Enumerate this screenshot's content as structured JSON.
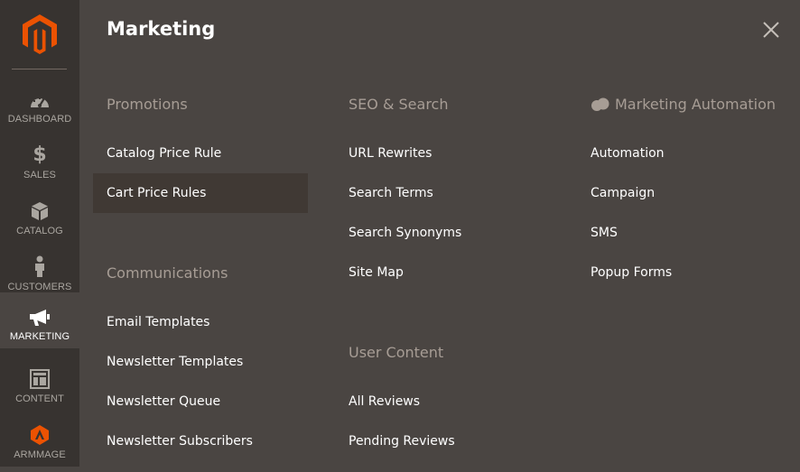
{
  "sidebar": {
    "items": [
      {
        "label": "DASHBOARD",
        "icon": "dashboard-icon"
      },
      {
        "label": "SALES",
        "icon": "dollar-icon"
      },
      {
        "label": "CATALOG",
        "icon": "box-icon"
      },
      {
        "label": "CUSTOMERS",
        "icon": "person-icon"
      },
      {
        "label": "MARKETING",
        "icon": "megaphone-icon",
        "active": true
      },
      {
        "label": "CONTENT",
        "icon": "layout-icon"
      },
      {
        "label": "ARMMAGE",
        "icon": "armmage-logo-icon"
      }
    ]
  },
  "panel": {
    "title": "Marketing",
    "columns": [
      {
        "sections": [
          {
            "title": "Promotions",
            "links": [
              "Catalog Price Rule",
              "Cart Price Rules"
            ]
          },
          {
            "title": "Communications",
            "links": [
              "Email Templates",
              "Newsletter Templates",
              "Newsletter Queue",
              "Newsletter Subscribers"
            ]
          }
        ]
      },
      {
        "sections": [
          {
            "title": "SEO & Search",
            "links": [
              "URL Rewrites",
              "Search Terms",
              "Search Synonyms",
              "Site Map"
            ]
          },
          {
            "title": "User Content",
            "links": [
              "All Reviews",
              "Pending Reviews"
            ]
          }
        ]
      },
      {
        "sections": [
          {
            "title": "Marketing Automation",
            "links": [
              "Automation",
              "Campaign",
              "SMS",
              "Popup Forms"
            ]
          }
        ]
      }
    ]
  },
  "colors": {
    "sidebar_bg": "#373330",
    "panel_bg": "#4a4542",
    "accent": "#eb5202",
    "section_title": "#a79d95",
    "hover_bg": "#403934"
  }
}
